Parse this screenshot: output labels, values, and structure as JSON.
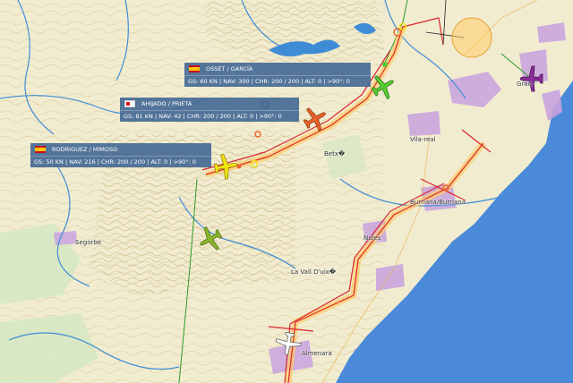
{
  "map": {
    "colors": {
      "land": "#f1ecd0",
      "sea": "#4a8ad8",
      "urban": "#c9a3df",
      "forest": "#d4e8c2",
      "river": "#3f8cd6",
      "track": "#d9272e",
      "track_buffer": "#ffcc66",
      "route": "#2a9a2a"
    },
    "places": [
      {
        "name": "Grao"
      },
      {
        "name": "Vila-real"
      },
      {
        "name": "Betx�"
      },
      {
        "name": "Burriana/Burriana"
      },
      {
        "name": "Nules"
      },
      {
        "name": "Segorbe"
      },
      {
        "name": "La Vall D'uix�"
      },
      {
        "name": "Almenara"
      }
    ]
  },
  "pilots": [
    {
      "flag": "es",
      "crew": "OSSET / GARCÍA",
      "stats": "GS: 60 KN | NAV: 300 | CHR: 200 / 200 | ALT: 0 | >90°: 0"
    },
    {
      "flag": "pl",
      "crew": "AHIJADO / PRIETA",
      "stats": "GS: 81 KN | NAV: 42 | CHR: 200 / 200 | ALT: 0 | >90°: 0"
    },
    {
      "flag": "es",
      "crew": "RODRIGUEZ / MIMOSO",
      "stats": "GS: 50 KN | NAV: 216 | CHR: 200 / 200 | ALT: 0 | >90°: 0"
    }
  ],
  "aircraft": [
    {
      "name": "green-plane",
      "color": "#55cc33"
    },
    {
      "name": "orange-plane",
      "color": "#e8622a"
    },
    {
      "name": "yellow-plane",
      "color": "#f2e310"
    },
    {
      "name": "olive-plane",
      "color": "#8bb52a"
    },
    {
      "name": "purple-plane",
      "color": "#8a2d9a"
    },
    {
      "name": "white-plane",
      "color": "#ffffff"
    }
  ]
}
